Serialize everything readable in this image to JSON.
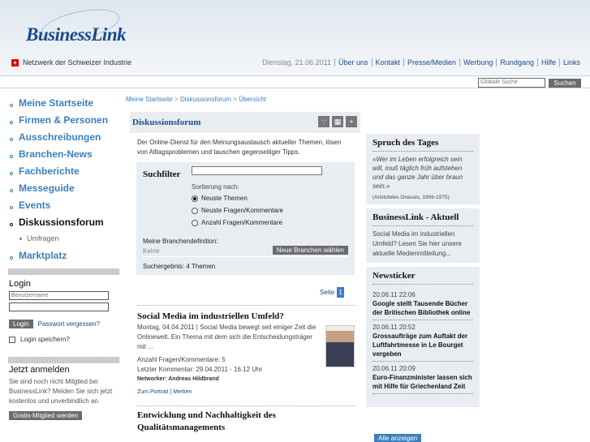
{
  "header": {
    "logo_text": "BusinessLink",
    "tagline": "Netzwerk der Schweizer Industrie",
    "flag_symbol": "+",
    "date": "Dienstag, 21.06.2011",
    "topnav": [
      "Über uns",
      "Kontakt",
      "Presse/Medien",
      "Werbung",
      "Rundgang",
      "Hilfe",
      "Links"
    ],
    "search_placeholder": "Globale Suche",
    "search_button": "Suchen"
  },
  "leftnav": {
    "items": [
      {
        "label": "Meine Startseite"
      },
      {
        "label": "Firmen & Personen"
      },
      {
        "label": "Ausschreibungen"
      },
      {
        "label": "Branchen-News"
      },
      {
        "label": "Fachberichte"
      },
      {
        "label": "Messeguide"
      },
      {
        "label": "Events"
      },
      {
        "label": "Diskussionsforum"
      },
      {
        "label": "Umfragen"
      },
      {
        "label": "Marktplatz"
      }
    ]
  },
  "login": {
    "title": "Login",
    "username_placeholder": "Benutzername",
    "button": "Login",
    "forgot": "Passwort vergessen?",
    "remember": "Login speichern?"
  },
  "register": {
    "title": "Jetzt anmelden",
    "text": "Sie sind noch nicht Mitglied bei BusinessLink? Melden Sie sich jetzt kostenlos und unverbindlich an.",
    "button": "Gratis-Mitglied werden"
  },
  "breadcrumb": {
    "part1": "Meine Startseite",
    "sep": " > ",
    "part2": "Diskussionsforum",
    "part3": "Übersicht"
  },
  "main": {
    "title": "Diskussionsforum",
    "icons": [
      "rss-icon",
      "chart-icon",
      "plus-icon"
    ],
    "intro": "Der Online-Dienst für den Meinungsaustausch aktueller Themen, lösen von Alltagsproblemen und tauschen gegenseitiger Tipps.",
    "filter": {
      "title": "Suchfilter",
      "sort_label": "Sortierung nach:",
      "options": [
        "Neuste Themen",
        "Neuste Fragen/Kommentare",
        "Anzahl Fragen/Kommentare"
      ],
      "selected": "Neuste Themen",
      "branche_label": "Meine Branchendefinition:",
      "branche_value": "Keine",
      "branche_button": "Neue Branchen wählen",
      "result": "Suchergebnis: 4 Themen"
    },
    "pager": {
      "label": "Seite",
      "current": "1"
    },
    "articles": [
      {
        "title": "Social Media im industriellen Umfeld?",
        "body": "Montag, 04.04.2011 | Social Media bewegt seit einiger Zeit die Onlinewelt. Ein Thema mit dem sich die Entscheidungsträger mit ...",
        "count": "Anzahl Fragen/Kommentare: 5",
        "last": "Letzter Kommentar: 29.04.2011 - 16.12 Uhr",
        "networker": "Networker: Andreas Hildbrand",
        "portrait": "Zum Portrait",
        "merken": "Merken"
      },
      {
        "title": "Entwicklung und Nachhaltigkeit des Qualitätsmanagements"
      }
    ]
  },
  "right": {
    "spruch": {
      "title": "Spruch des Tages",
      "quote": "«Wer im Leben erfolgreich sein will, muß täglich früh aufstehen und das ganze Jahr über braun sein.»",
      "author": "(Aristoteles Onassis, 1906-1975)"
    },
    "aktuell": {
      "title": "BusinessLink - Aktuell",
      "text": "Social Media im industriellen Umfeld? Lesen Sie hier unsere aktuelle Medienmitteilung..."
    },
    "newsticker": {
      "title": "Newsticker",
      "items": [
        {
          "date": "20.06.11 22:06",
          "text": "Google stellt Tausende Bücher der Britischen Bibliothek online"
        },
        {
          "date": "20.06.11 20:52",
          "text": "Grossaufträge zum Auftakt der Luftfahrtmesse in Le Bourget vergeben"
        },
        {
          "date": "20.06.11 20:09",
          "text": "Euro-Finanzminister lassen sich mit Hilfe für Griechenland Zeit"
        }
      ],
      "button": "Alle anzeigen"
    }
  }
}
